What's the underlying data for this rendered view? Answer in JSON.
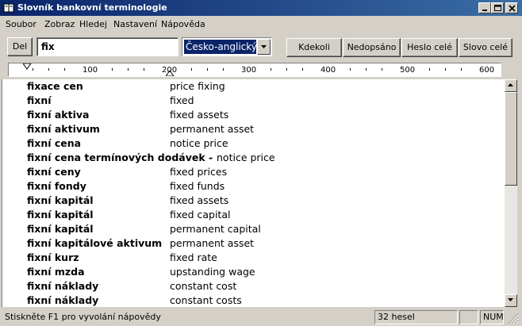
{
  "window": {
    "title": "Slovník bankovní terminologie"
  },
  "menu": [
    "Soubor",
    "Zobraz",
    "Hledej",
    "Nastavení",
    "Nápověda"
  ],
  "toolbar": {
    "del_label": "Del",
    "search_value": "fix",
    "direction_selected": "Česko-anglický",
    "buttons": [
      "Kdekoli",
      "Nedopsáno",
      "Heslo celé",
      "Slovo celé"
    ]
  },
  "ruler": {
    "labels": [
      "100",
      "200",
      "300",
      "400",
      "500",
      "600"
    ]
  },
  "entries": [
    {
      "term": "fixace cen",
      "translation": "price fixing"
    },
    {
      "term": "fixní",
      "translation": "fixed"
    },
    {
      "term": "fixní aktiva",
      "translation": "fixed assets"
    },
    {
      "term": "fixní aktivum",
      "translation": "permanent asset"
    },
    {
      "term": "fixní cena",
      "translation": "notice price"
    },
    {
      "term": "fixní cena termínových dodávek -",
      "translation": "notice price",
      "inline": true
    },
    {
      "term": "fixní ceny",
      "translation": "fixed prices"
    },
    {
      "term": "fixní fondy",
      "translation": "fixed funds"
    },
    {
      "term": "fixní kapitál",
      "translation": "fixed assets"
    },
    {
      "term": "fixní kapitál",
      "translation": "fixed capital"
    },
    {
      "term": "fixní kapitál",
      "translation": "permanent capital"
    },
    {
      "term": "fixní kapitálové aktivum",
      "translation": "permanent asset"
    },
    {
      "term": "fixní kurz",
      "translation": "fixed rate"
    },
    {
      "term": "fixní mzda",
      "translation": "upstanding wage"
    },
    {
      "term": "fixní náklady",
      "translation": "constant cost"
    },
    {
      "term": "fixní náklady",
      "translation": "constant costs"
    }
  ],
  "status": {
    "help": "Stiskněte F1 pro vyvolání nápovědy",
    "count": "32 hesel",
    "num": "NUM"
  },
  "colors": {
    "title_start": "#0a246a",
    "title_end": "#3a6ea5",
    "selection": "#0a246a",
    "face": "#d4d0c8"
  }
}
